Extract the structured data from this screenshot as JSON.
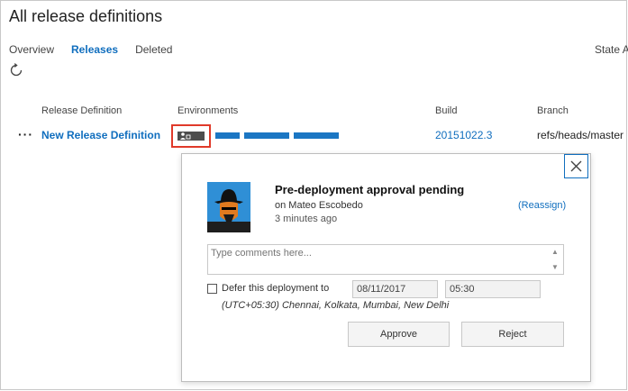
{
  "page": {
    "title": "All release definitions"
  },
  "tabs": [
    {
      "label": "Overview",
      "active": false
    },
    {
      "label": "Releases",
      "active": true
    },
    {
      "label": "Deleted",
      "active": false
    }
  ],
  "toolbar": {
    "state_label": "State",
    "state_value_partial": "A",
    "refresh_icon": "refresh-icon"
  },
  "columns": {
    "release_definition": "Release Definition",
    "environments": "Environments",
    "build": "Build",
    "branch": "Branch"
  },
  "row": {
    "more": "···",
    "definition": "New Release Definition",
    "build": "20151022.3",
    "branch": "refs/heads/master",
    "environment_icon": "pending-approval-icon"
  },
  "colors": {
    "accent": "#106ebe",
    "env_bar": "#1b76c3",
    "highlight": "#e03a2a",
    "pending": "#4d4d4d"
  },
  "approval": {
    "title": "Pre-deployment approval pending",
    "approver": "on Mateo Escobedo",
    "time": "3 minutes ago",
    "reassign": "(Reassign)",
    "comment_placeholder": "Type comments here...",
    "defer_label": "Defer this deployment to",
    "defer_date": "08/11/2017",
    "defer_time": "05:30",
    "timezone": "(UTC+05:30) Chennai, Kolkata, Mumbai, New Delhi",
    "approve": "Approve",
    "reject": "Reject",
    "close_icon": "close-icon"
  }
}
